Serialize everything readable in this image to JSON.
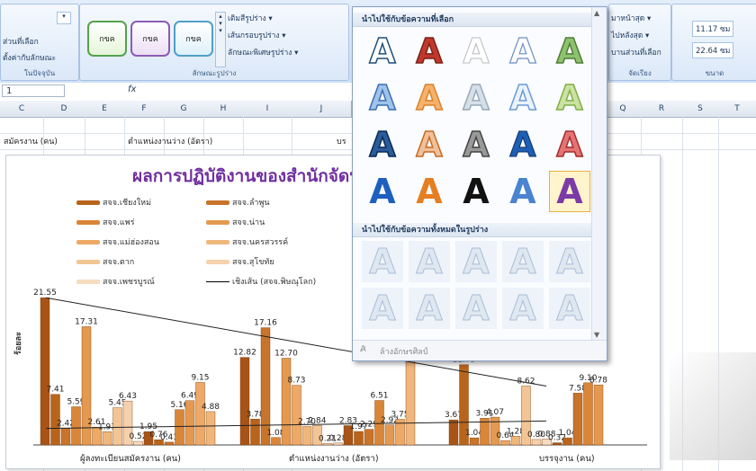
{
  "ribbon": {
    "left_items": [
      "ส่วนที่เลือก",
      "ตั้งค่ากับลักษณะ",
      "ในปัจจุบัน"
    ],
    "shape_styles": [
      "กขค",
      "กขค",
      "กขค"
    ],
    "shape_cmds": [
      "เติมสีรูปร่าง ▾",
      "เส้นกรอบรูปร่าง ▾",
      "ลักษณะพิเศษรูปร่าง ▾"
    ],
    "shape_styles_label": "ลักษณะรูปร่าง",
    "arrange_items": [
      "มาหน้าสุด ▾",
      "ไปหลังสุด ▾",
      "บานส่วนที่เลือก"
    ],
    "arrange_label": "จัดเรียง",
    "size_height": "11.17 ซม",
    "size_width": "22.64 ซม",
    "size_label": "ขนาด"
  },
  "formula_bar": {
    "name_box": "1",
    "fx": "fx"
  },
  "grid": {
    "columns": [
      "C",
      "D",
      "E",
      "F",
      "G",
      "H",
      "I",
      "J",
      "",
      "",
      "",
      "Q",
      "R",
      "S",
      "T"
    ],
    "row1_c": "สมัครงาน (คน)",
    "row1_f": "ตำแหน่งงานว่าง (อัตรา)",
    "row1_j": "บร"
  },
  "panel": {
    "section1": "นำไปใช้กับข้อความที่เลือก",
    "section2": "นำไปใช้กับข้อความทั้งหมดในรูปร่าง",
    "clear_label": "ล้างอักษรศิลป์",
    "glyph": "A"
  },
  "chart_data": {
    "type": "bar",
    "title": "ผลการปฏิบัติงานของสำนักจัดหา",
    "ylabel": "ร้อยละ",
    "categories": [
      "ผู้ลงทะเบียนสมัครงาน (คน)",
      "ตำแหน่งงานว่าง (อัตรา)",
      "บรรจุงาน (คน)"
    ],
    "legend": [
      "สจจ.เชียงใหม่",
      "สจจ.ลำพูน",
      "สจจ.แพร่",
      "สจจ.น่าน",
      "สจจ.แม่ฮ่องสอน",
      "สจจ.นครสวรรค์",
      "สจจ.ตาก",
      "สจจ.สุโขทัย",
      "สจจ.เพชรบูรณ์",
      "เชิงเส้น (สจจ.พิษณุโลก)"
    ],
    "group_values": [
      [
        21.55,
        7.41,
        2.42,
        5.59,
        17.31,
        2.61,
        1.93,
        5.45,
        6.43,
        0.52,
        1.95,
        0.76,
        0.41,
        5.16,
        6.49,
        9.15,
        4.88
      ],
      [
        12.82,
        3.78,
        17.16,
        1.08,
        12.7,
        8.73,
        2.7,
        2.84,
        0.21,
        0.28,
        2.83,
        1.97,
        2.29,
        6.51,
        2.92,
        3.75,
        17.0
      ],
      [
        3.67,
        11.75,
        1.04,
        3.91,
        4.07,
        0.64,
        1.28,
        8.62,
        0.8,
        0.88,
        0.32,
        1.04,
        7.58,
        9.1,
        8.78
      ]
    ],
    "trendlines": [
      {
        "from": 21.55,
        "to": 8.62
      },
      {
        "from": 2.42,
        "to": 3.5
      }
    ]
  }
}
